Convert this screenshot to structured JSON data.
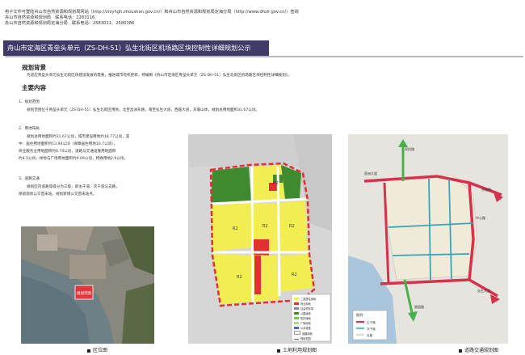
{
  "header": {
    "line1": "电子文件可登陆舟山市自然资源和规划局网站（http://zrzyhgh.zhoushan.gov.cn/）和舟山市自然资源和规划局定海分局（http://www.dhzlr.gov.cn/）查询",
    "line2": "舟山市自然资源和规划局　联系电话：2283116",
    "line3": "舟山市自然资源和规划局定海分局　联系电话：2583011、2580386"
  },
  "title": "舟山市定海区青垒头单元（ZS-DH-51）弘生北街区机场路区块控制性详细规划公示",
  "background": {
    "heading": "规划背景",
    "text": "为适应青垒头单元弘生北街区块建设发展的需要，推进城市有机更新，特编制《舟山市定海区青垒头单元（ZS-DH-51）弘生北街区机场路区块控制性详细规划》。"
  },
  "content": {
    "heading": "主要内容",
    "s1_title": "1、规划范围",
    "s1_text": "规划范围位于青垒头单元（ZS-DH-51）弘生北街区用地，北至昌洲东路，南至弘生大道，西临大道，东靠山体，规划总用地面积31.67公顷。",
    "s2_title": "2、用地布局",
    "s2_l1": "规划总用地面积约31.67公顷，城市建设用地约18.77公顷，其",
    "s2_l2": "中：居住用地面积约13.94公顷（保障居住用地10.7公顷），",
    "s2_l3": "商业服务业用地面积约0.74公顷，道路与交通设施用地面积",
    "s2_l4": "约4.1公顷，绿地与广场用地面积约0.09公顷，特殊用地2.9公顷。",
    "s3_title": "3、道路交通",
    "s3_l1": "规划区内道路等级分为三级，即主干道、次干道与支路，",
    "s3_l2": "保留现状公交首末站，规划新增公交首末站点。"
  },
  "captions": {
    "location": "区位图",
    "landuse": "土地利用规划图",
    "road": "道路交通规划图"
  },
  "map_labels": {
    "location_tag": "规划范围",
    "landuse_legend": [
      "二类居住用地",
      "商业用地",
      "社会停车场",
      "公园绿地",
      "防护绿地",
      "广场用地",
      "公共设施",
      "道路用地",
      "规划范围"
    ],
    "road_legend_title": "图例",
    "road_legend": [
      "主干路",
      "次干路",
      "支路"
    ],
    "road_names": [
      "昌洲大道",
      "东港路",
      "弘生大道",
      "双桥路",
      "香园路",
      "中心路"
    ]
  },
  "colors": {
    "title_bg": "#3f3a68",
    "residential": "#f2ee52",
    "commercial": "#e0302f",
    "green": "#3f8a2f",
    "boundary": "#e03030",
    "main_road": "#d9314b",
    "secondary_road": "#3aa4b8",
    "arrow_green": "#49b04a"
  }
}
